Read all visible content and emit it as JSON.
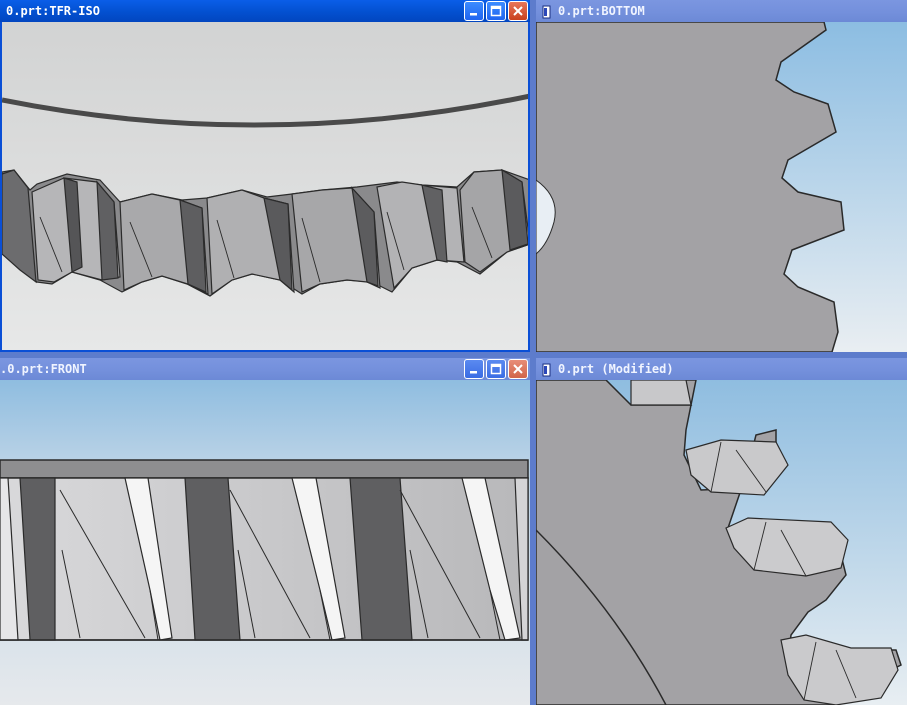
{
  "windows": {
    "top_left": {
      "title": "0.prt:TFR-ISO",
      "active": true
    },
    "top_right": {
      "title": "0.prt:BOTTOM",
      "active": false
    },
    "bottom_left": {
      "title": ".0.prt:FRONT",
      "active": false
    },
    "bottom_right": {
      "title": "0.prt (Modified)",
      "active": false
    }
  },
  "icons": {
    "minimize": "minimize-icon",
    "maximize": "maximize-icon",
    "close": "close-icon",
    "part": "part-document-icon"
  },
  "colors": {
    "titlebar_active": "#0350d0",
    "titlebar_inactive": "#7490dc",
    "model_grey": "#a3a2a5",
    "background_top": "#8fbde0",
    "background_bottom": "#e6ebef"
  }
}
